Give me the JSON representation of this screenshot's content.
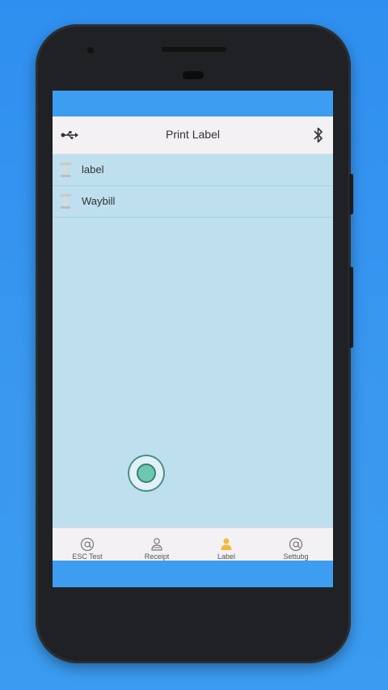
{
  "topbar": {
    "title": "Print Label",
    "left_icon": "usb-icon",
    "right_icon": "bluetooth-icon"
  },
  "list": {
    "items": [
      {
        "label": "label",
        "icon": "label-printer-icon"
      },
      {
        "label": "Waybill",
        "icon": "label-printer-icon"
      }
    ]
  },
  "tabs": [
    {
      "label": "ESC Test",
      "icon": "at-sign-icon"
    },
    {
      "label": "Receipt",
      "icon": "receipt-printer-icon"
    },
    {
      "label": "Label",
      "icon": "label-user-icon",
      "active": true
    },
    {
      "label": "Settubg",
      "icon": "at-sign-icon"
    }
  ],
  "colors": {
    "status_bar": "#3c9df1",
    "content_background": "#bee0ee",
    "topbar_background": "#f4f1f4",
    "active_tab": "#f2b93b",
    "background": "#2f8ff0"
  }
}
